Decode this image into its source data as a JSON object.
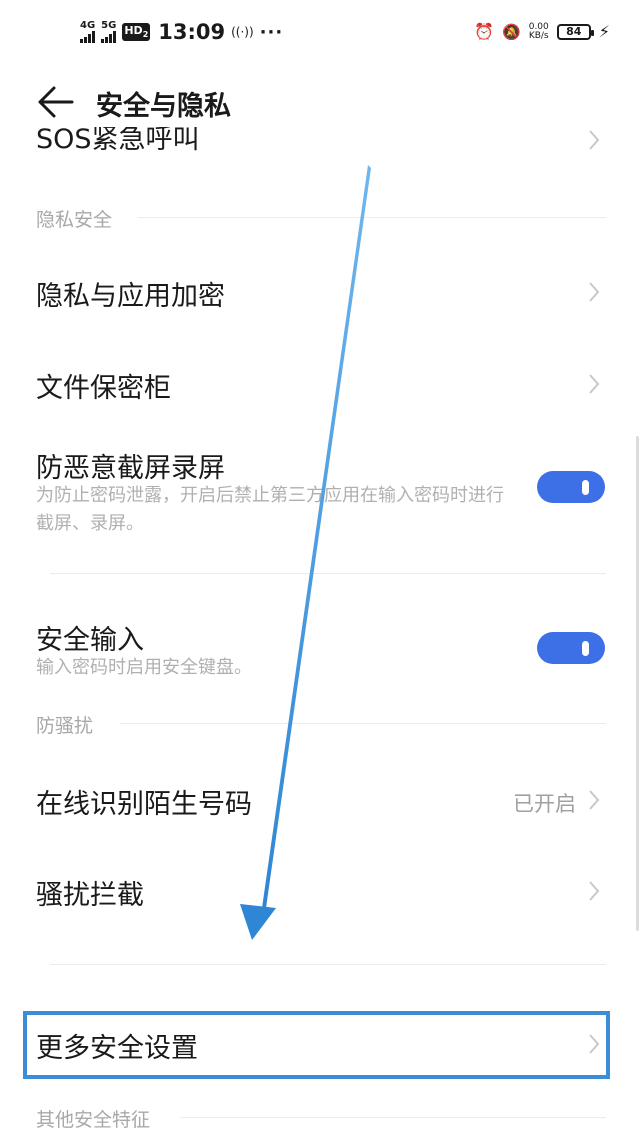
{
  "status_bar": {
    "net1": "4G",
    "net2": "5G",
    "hd": "HD",
    "hd_sub": "2",
    "time": "13:09",
    "hotspot": "((·))",
    "more": "···",
    "speed_value": "0.00",
    "speed_unit": "KB/s",
    "battery": "84",
    "bolt": "⚡",
    "alarm": "⏰",
    "mute": "🔕"
  },
  "header": {
    "title": "安全与隐私"
  },
  "top_partial": {
    "label": "SOS紧急呼叫"
  },
  "sections": {
    "privacy": "隐私安全",
    "harassment": "防骚扰",
    "other": "其他安全特征"
  },
  "items": {
    "privacy_app_encrypt": "隐私与应用加密",
    "file_vault": "文件保密柜",
    "anti_screenshot": {
      "label": "防恶意截屏录屏",
      "desc": "为防止密码泄露，开启后禁止第三方应用在输入密码时进行截屏、录屏。",
      "enabled": true
    },
    "secure_input": {
      "label": "安全输入",
      "desc": "输入密码时启用安全键盘。",
      "enabled": true
    },
    "online_identify": {
      "label": "在线识别陌生号码",
      "value": "已开启"
    },
    "harass_block": "骚扰拦截",
    "more_security": "更多安全设置"
  },
  "colors": {
    "accent": "#3d6fe6",
    "annotation": "#3b8ed6"
  }
}
